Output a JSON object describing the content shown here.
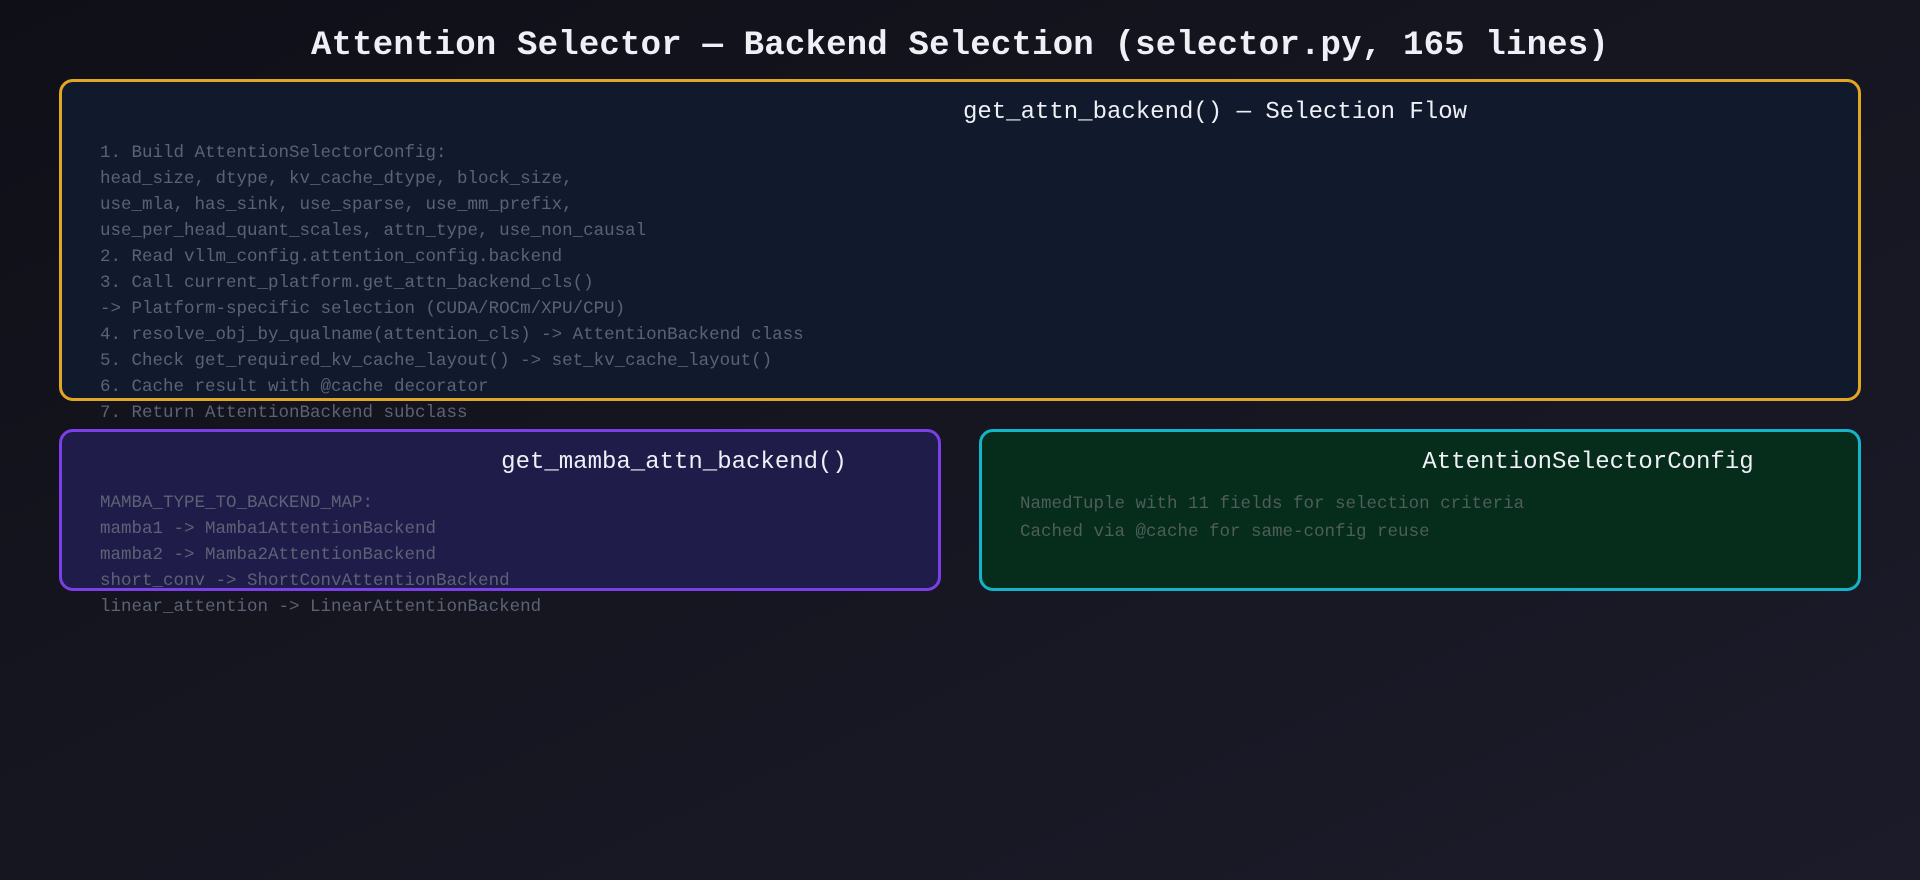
{
  "title": "Attention Selector — Backend Selection (selector.py, 165 lines)",
  "boxes": {
    "flow": {
      "title": "get_attn_backend() — Selection Flow",
      "lines": [
        "1. Build AttentionSelectorConfig:",
        "head_size, dtype, kv_cache_dtype, block_size,",
        "use_mla, has_sink, use_sparse, use_mm_prefix,",
        "use_per_head_quant_scales, attn_type, use_non_causal",
        "2. Read vllm_config.attention_config.backend",
        "3. Call current_platform.get_attn_backend_cls()",
        "-> Platform-specific selection (CUDA/ROCm/XPU/CPU)",
        "4. resolve_obj_by_qualname(attention_cls) -> AttentionBackend class",
        "5. Check get_required_kv_cache_layout() -> set_kv_cache_layout()",
        "6. Cache result with @cache decorator",
        "7. Return AttentionBackend subclass"
      ],
      "border_color": "#e1a722",
      "fill_color": "#101a2c"
    },
    "mamba": {
      "title": "get_mamba_attn_backend()",
      "lines": [
        "MAMBA_TYPE_TO_BACKEND_MAP:",
        "mamba1 -> Mamba1AttentionBackend",
        "mamba2 -> Mamba2AttentionBackend",
        "short_conv -> ShortConvAttentionBackend",
        "linear_attention -> LinearAttentionBackend"
      ],
      "border_color": "#7a3fe6",
      "fill_color": "#1f1c4a"
    },
    "config": {
      "title": "AttentionSelectorConfig",
      "lines": [
        "NamedTuple with 11 fields for selection criteria",
        "Cached via @cache for same-config reuse"
      ],
      "border_color": "#15b4c8",
      "fill_color": "#062c1b"
    }
  }
}
